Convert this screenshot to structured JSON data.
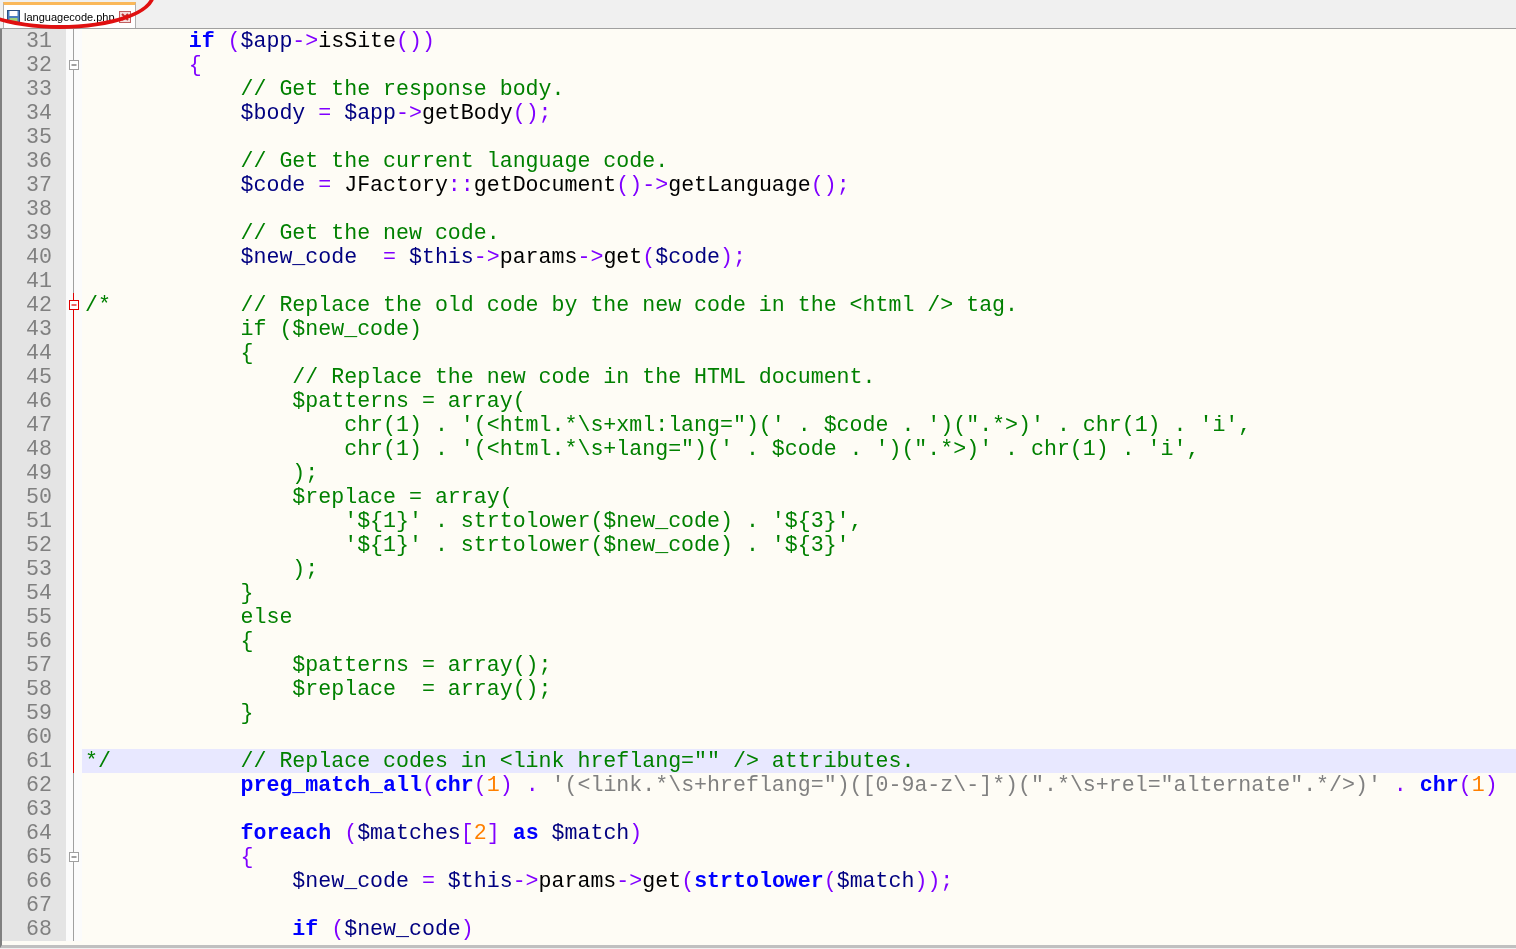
{
  "tabs": [
    {
      "label": "languagecode.php",
      "selected": true
    }
  ],
  "editor": {
    "lines": [
      {
        "number": "31",
        "fold_start": false,
        "fold_highlight": false,
        "current": false,
        "tokens": [
          {
            "kind": "keyword",
            "text": "        if"
          },
          {
            "kind": "operator",
            "text": " ("
          },
          {
            "kind": "variable",
            "text": "$app"
          },
          {
            "kind": "operator",
            "text": "->"
          },
          {
            "kind": "identifier",
            "text": "isSite"
          },
          {
            "kind": "operator",
            "text": "())"
          }
        ]
      },
      {
        "number": "32",
        "fold_start": true,
        "fold_highlight": false,
        "current": false,
        "tokens": [
          {
            "kind": "operator",
            "text": "        {"
          }
        ]
      },
      {
        "number": "33",
        "fold_start": false,
        "fold_highlight": false,
        "current": false,
        "tokens": [
          {
            "kind": "comment",
            "text": "            // Get the response body."
          }
        ]
      },
      {
        "number": "34",
        "fold_start": false,
        "fold_highlight": false,
        "current": false,
        "tokens": [
          {
            "kind": "variable",
            "text": "            $body"
          },
          {
            "kind": "operator",
            "text": " = "
          },
          {
            "kind": "variable",
            "text": "$app"
          },
          {
            "kind": "operator",
            "text": "->"
          },
          {
            "kind": "identifier",
            "text": "getBody"
          },
          {
            "kind": "operator",
            "text": "();"
          }
        ]
      },
      {
        "number": "35",
        "fold_start": false,
        "fold_highlight": false,
        "current": false
      },
      {
        "number": "36",
        "fold_start": false,
        "fold_highlight": false,
        "current": false,
        "tokens": [
          {
            "kind": "comment",
            "text": "            // Get the current language code."
          }
        ]
      },
      {
        "number": "37",
        "fold_start": false,
        "fold_highlight": false,
        "current": false,
        "tokens": [
          {
            "kind": "variable",
            "text": "            $code"
          },
          {
            "kind": "operator",
            "text": " = "
          },
          {
            "kind": "identifier",
            "text": "JFactory"
          },
          {
            "kind": "operator",
            "text": "::"
          },
          {
            "kind": "identifier",
            "text": "getDocument"
          },
          {
            "kind": "operator",
            "text": "()->"
          },
          {
            "kind": "identifier",
            "text": "getLanguage"
          },
          {
            "kind": "operator",
            "text": "();"
          }
        ]
      },
      {
        "number": "38",
        "fold_start": false,
        "fold_highlight": false,
        "current": false
      },
      {
        "number": "39",
        "fold_start": false,
        "fold_highlight": false,
        "current": false,
        "tokens": [
          {
            "kind": "comment",
            "text": "            // Get the new code."
          }
        ]
      },
      {
        "number": "40",
        "fold_start": false,
        "fold_highlight": false,
        "current": false,
        "tokens": [
          {
            "kind": "variable",
            "text": "            $new_code"
          },
          {
            "kind": "operator",
            "text": "  = "
          },
          {
            "kind": "variable",
            "text": "$this"
          },
          {
            "kind": "operator",
            "text": "->"
          },
          {
            "kind": "identifier",
            "text": "params"
          },
          {
            "kind": "operator",
            "text": "->"
          },
          {
            "kind": "identifier",
            "text": "get"
          },
          {
            "kind": "operator",
            "text": "("
          },
          {
            "kind": "variable",
            "text": "$code"
          },
          {
            "kind": "operator",
            "text": ");"
          }
        ]
      },
      {
        "number": "41",
        "fold_start": false,
        "fold_highlight": false,
        "current": false
      },
      {
        "number": "42",
        "fold_start": true,
        "fold_highlight": true,
        "current": false,
        "tokens": [
          {
            "kind": "comment",
            "text": "/*          // Replace the old code by the new code in the <html /> tag."
          }
        ]
      },
      {
        "number": "43",
        "fold_start": false,
        "fold_highlight": true,
        "current": false,
        "tokens": [
          {
            "kind": "comment",
            "text": "            if ($new_code)"
          }
        ]
      },
      {
        "number": "44",
        "fold_start": false,
        "fold_highlight": true,
        "current": false,
        "tokens": [
          {
            "kind": "comment",
            "text": "            {"
          }
        ]
      },
      {
        "number": "45",
        "fold_start": false,
        "fold_highlight": true,
        "current": false,
        "tokens": [
          {
            "kind": "comment",
            "text": "                // Replace the new code in the HTML document."
          }
        ]
      },
      {
        "number": "46",
        "fold_start": false,
        "fold_highlight": true,
        "current": false,
        "tokens": [
          {
            "kind": "comment",
            "text": "                $patterns = array("
          }
        ]
      },
      {
        "number": "47",
        "fold_start": false,
        "fold_highlight": true,
        "current": false,
        "tokens": [
          {
            "kind": "comment",
            "text": "                    chr(1) . '(<html.*\\s+xml:lang=\")(' . $code . ')(\".*>)' . chr(1) . 'i',"
          }
        ]
      },
      {
        "number": "48",
        "fold_start": false,
        "fold_highlight": true,
        "current": false,
        "tokens": [
          {
            "kind": "comment",
            "text": "                    chr(1) . '(<html.*\\s+lang=\")(' . $code . ')(\".*>)' . chr(1) . 'i',"
          }
        ]
      },
      {
        "number": "49",
        "fold_start": false,
        "fold_highlight": true,
        "current": false,
        "tokens": [
          {
            "kind": "comment",
            "text": "                );"
          }
        ]
      },
      {
        "number": "50",
        "fold_start": false,
        "fold_highlight": true,
        "current": false,
        "tokens": [
          {
            "kind": "comment",
            "text": "                $replace = array("
          }
        ]
      },
      {
        "number": "51",
        "fold_start": false,
        "fold_highlight": true,
        "current": false,
        "tokens": [
          {
            "kind": "comment",
            "text": "                    '${1}' . strtolower($new_code) . '${3}',"
          }
        ]
      },
      {
        "number": "52",
        "fold_start": false,
        "fold_highlight": true,
        "current": false,
        "tokens": [
          {
            "kind": "comment",
            "text": "                    '${1}' . strtolower($new_code) . '${3}'"
          }
        ]
      },
      {
        "number": "53",
        "fold_start": false,
        "fold_highlight": true,
        "current": false,
        "tokens": [
          {
            "kind": "comment",
            "text": "                );"
          }
        ]
      },
      {
        "number": "54",
        "fold_start": false,
        "fold_highlight": true,
        "current": false,
        "tokens": [
          {
            "kind": "comment",
            "text": "            }"
          }
        ]
      },
      {
        "number": "55",
        "fold_start": false,
        "fold_highlight": true,
        "current": false,
        "tokens": [
          {
            "kind": "comment",
            "text": "            else"
          }
        ]
      },
      {
        "number": "56",
        "fold_start": false,
        "fold_highlight": true,
        "current": false,
        "tokens": [
          {
            "kind": "comment",
            "text": "            {"
          }
        ]
      },
      {
        "number": "57",
        "fold_start": false,
        "fold_highlight": true,
        "current": false,
        "tokens": [
          {
            "kind": "comment",
            "text": "                $patterns = array();"
          }
        ]
      },
      {
        "number": "58",
        "fold_start": false,
        "fold_highlight": true,
        "current": false,
        "tokens": [
          {
            "kind": "comment",
            "text": "                $replace  = array();"
          }
        ]
      },
      {
        "number": "59",
        "fold_start": false,
        "fold_highlight": true,
        "current": false,
        "tokens": [
          {
            "kind": "comment",
            "text": "            }"
          }
        ]
      },
      {
        "number": "60",
        "fold_start": false,
        "fold_highlight": true,
        "current": false
      },
      {
        "number": "61",
        "fold_start": false,
        "fold_highlight": true,
        "current": true,
        "tokens": [
          {
            "kind": "comment",
            "text": "*/          // Replace codes in <link hreflang=\"\" /> attributes."
          }
        ]
      },
      {
        "number": "62",
        "fold_start": false,
        "fold_highlight": false,
        "current": false,
        "tokens": [
          {
            "kind": "keyword",
            "text": "            preg_match_all"
          },
          {
            "kind": "operator",
            "text": "("
          },
          {
            "kind": "keyword",
            "text": "chr"
          },
          {
            "kind": "operator",
            "text": "("
          },
          {
            "kind": "number",
            "text": "1"
          },
          {
            "kind": "operator",
            "text": ") . "
          },
          {
            "kind": "string",
            "text": "'(<link.*\\s+hreflang=\")([0-9a-z\\-]*)(\".*\\s+rel=\"alternate\".*/>)'"
          },
          {
            "kind": "operator",
            "text": " . "
          },
          {
            "kind": "keyword",
            "text": "chr"
          },
          {
            "kind": "operator",
            "text": "("
          },
          {
            "kind": "number",
            "text": "1"
          },
          {
            "kind": "operator",
            "text": ")"
          }
        ]
      },
      {
        "number": "63",
        "fold_start": false,
        "fold_highlight": false,
        "current": false
      },
      {
        "number": "64",
        "fold_start": false,
        "fold_highlight": false,
        "current": false,
        "tokens": [
          {
            "kind": "keyword",
            "text": "            foreach"
          },
          {
            "kind": "operator",
            "text": " ("
          },
          {
            "kind": "variable",
            "text": "$matches"
          },
          {
            "kind": "operator",
            "text": "["
          },
          {
            "kind": "number",
            "text": "2"
          },
          {
            "kind": "operator",
            "text": "] "
          },
          {
            "kind": "keyword",
            "text": "as"
          },
          {
            "kind": "variable",
            "text": " $match"
          },
          {
            "kind": "operator",
            "text": ")"
          }
        ]
      },
      {
        "number": "65",
        "fold_start": true,
        "fold_highlight": false,
        "current": false,
        "tokens": [
          {
            "kind": "operator",
            "text": "            {"
          }
        ]
      },
      {
        "number": "66",
        "fold_start": false,
        "fold_highlight": false,
        "current": false,
        "tokens": [
          {
            "kind": "variable",
            "text": "                $new_code"
          },
          {
            "kind": "operator",
            "text": " = "
          },
          {
            "kind": "variable",
            "text": "$this"
          },
          {
            "kind": "operator",
            "text": "->"
          },
          {
            "kind": "identifier",
            "text": "params"
          },
          {
            "kind": "operator",
            "text": "->"
          },
          {
            "kind": "identifier",
            "text": "get"
          },
          {
            "kind": "operator",
            "text": "("
          },
          {
            "kind": "keyword",
            "text": "strtolower"
          },
          {
            "kind": "operator",
            "text": "("
          },
          {
            "kind": "variable",
            "text": "$match"
          },
          {
            "kind": "operator",
            "text": "));"
          }
        ]
      },
      {
        "number": "67",
        "fold_start": false,
        "fold_highlight": false,
        "current": false
      },
      {
        "number": "68",
        "fold_start": false,
        "fold_highlight": false,
        "current": false,
        "tokens": [
          {
            "kind": "keyword",
            "text": "                if"
          },
          {
            "kind": "operator",
            "text": " ("
          },
          {
            "kind": "variable",
            "text": "$new_code"
          },
          {
            "kind": "operator",
            "text": ")"
          }
        ]
      }
    ]
  }
}
